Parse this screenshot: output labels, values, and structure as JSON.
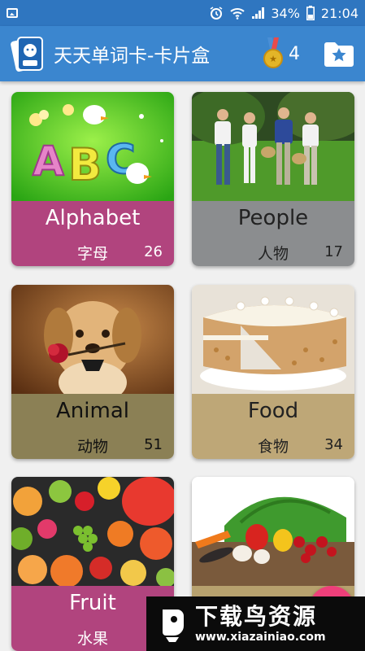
{
  "status_bar": {
    "battery": "34%",
    "time": "21:04"
  },
  "app_bar": {
    "title": "天天单词卡-卡片盒",
    "medal_count": "4"
  },
  "categories": [
    {
      "en": "Alphabet",
      "cn": "字母",
      "count": "26",
      "color": "#b1447e",
      "text_color": "#ffffff",
      "image": "alphabet-image"
    },
    {
      "en": "People",
      "cn": "人物",
      "count": "17",
      "color": "#8b8d8f",
      "text_color": "#222222",
      "image": "people-image"
    },
    {
      "en": "Animal",
      "cn": "动物",
      "count": "51",
      "color": "#8b8055",
      "text_color": "#111111",
      "image": "animal-image"
    },
    {
      "en": "Food",
      "cn": "食物",
      "count": "34",
      "color": "#bea777",
      "text_color": "#222222",
      "image": "food-image"
    },
    {
      "en": "Fruit",
      "cn": "水果",
      "count": "",
      "color": "#b1447e",
      "text_color": "#ffffff",
      "image": "fruit-image"
    },
    {
      "en": "",
      "cn": "",
      "count": "",
      "color": "#b7a16e",
      "text_color": "#222222",
      "image": "vegetable-image"
    }
  ],
  "watermark": {
    "title": "下载鸟资源",
    "url": "www.xiazainiao.com"
  },
  "colors": {
    "status_bar": "#2f76c0",
    "app_bar": "#3b86cf",
    "fab": "#ee3f7a"
  }
}
